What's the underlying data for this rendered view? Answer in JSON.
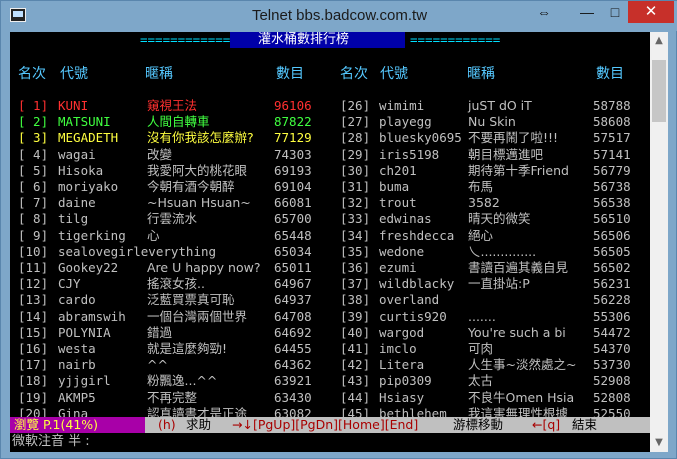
{
  "window": {
    "title": "Telnet bbs.badcow.com.tw",
    "min": "—",
    "max": "□",
    "close": "✕",
    "resize": "⇔"
  },
  "banner": {
    "left_rule": "============",
    "title": "灌水桶數排行榜",
    "right_rule": "============"
  },
  "headers": {
    "rank": "名次",
    "id": "代號",
    "nick": "暱稱",
    "count": "數目"
  },
  "left": [
    {
      "rank": "[ 1]",
      "id": "KUNI",
      "nick": "窺視王法",
      "count": "96106",
      "color": "red"
    },
    {
      "rank": "[ 2]",
      "id": "MATSUNI",
      "nick": "人間自轉車",
      "count": "87822",
      "color": "green"
    },
    {
      "rank": "[ 3]",
      "id": "MEGADETH",
      "nick": "沒有你我該怎麼辦?",
      "count": "77129",
      "color": "yellow"
    },
    {
      "rank": "[ 4]",
      "id": "wagai",
      "nick": "改變",
      "count": "74303",
      "color": "white"
    },
    {
      "rank": "[ 5]",
      "id": "Hisoka",
      "nick": "我愛阿大的桃花眼",
      "count": "69193",
      "color": "white"
    },
    {
      "rank": "[ 6]",
      "id": "moriyako",
      "nick": "今朝有酒今朝醉",
      "count": "69104",
      "color": "white"
    },
    {
      "rank": "[ 7]",
      "id": "daine",
      "nick": "~Hsuan Hsuan~",
      "count": "66081",
      "color": "white"
    },
    {
      "rank": "[ 8]",
      "id": "tilg",
      "nick": "行雲流水",
      "count": "65700",
      "color": "white"
    },
    {
      "rank": "[ 9]",
      "id": "tigerking",
      "nick": "心",
      "count": "65448",
      "color": "white"
    },
    {
      "rank": "[10]",
      "id": "sealovegirleverything",
      "nick": "",
      "count": "65034",
      "color": "white"
    },
    {
      "rank": "[11]",
      "id": "Gookey22",
      "nick": "Are U happy now?",
      "count": "65011",
      "color": "white"
    },
    {
      "rank": "[12]",
      "id": "CJY",
      "nick": "搖滾女孩..",
      "count": "64967",
      "color": "white"
    },
    {
      "rank": "[13]",
      "id": "cardo",
      "nick": "泛藍買票真可恥",
      "count": "64937",
      "color": "white"
    },
    {
      "rank": "[14]",
      "id": "abramswih",
      "nick": "一個台灣兩個世界",
      "count": "64708",
      "color": "white"
    },
    {
      "rank": "[15]",
      "id": "POLYNIA",
      "nick": "錯過",
      "count": "64692",
      "color": "white"
    },
    {
      "rank": "[16]",
      "id": "westa",
      "nick": "就是這麼夠勁!",
      "count": "64455",
      "color": "white"
    },
    {
      "rank": "[17]",
      "id": "nairb",
      "nick": "^^",
      "count": "64362",
      "color": "white"
    },
    {
      "rank": "[18]",
      "id": "yjjgirl",
      "nick": "粉飄逸...^^",
      "count": "63921",
      "color": "white"
    },
    {
      "rank": "[19]",
      "id": "AKMP5",
      "nick": "不再完整",
      "count": "63430",
      "color": "white"
    },
    {
      "rank": "[20]",
      "id": "Gina",
      "nick": "認真讀書才是正途",
      "count": "63082",
      "color": "white"
    }
  ],
  "right": [
    {
      "rank": "[26]",
      "id": "wimimi",
      "nick": "juST dO iT",
      "count": "58788"
    },
    {
      "rank": "[27]",
      "id": "playegg",
      "nick": "Nu Skin",
      "count": "58608"
    },
    {
      "rank": "[28]",
      "id": "bluesky0695",
      "nick": "不要再鬧了啦!!!",
      "count": "57517"
    },
    {
      "rank": "[29]",
      "id": "iris5198",
      "nick": "朝目標邁進吧",
      "count": "57141"
    },
    {
      "rank": "[30]",
      "id": "ch201",
      "nick": "期待第十季Friend",
      "count": "56779"
    },
    {
      "rank": "[31]",
      "id": "buma",
      "nick": "布馬",
      "count": "56738"
    },
    {
      "rank": "[32]",
      "id": "trout",
      "nick": "3582",
      "count": "56538"
    },
    {
      "rank": "[33]",
      "id": "edwinas",
      "nick": "晴天的微笑",
      "count": "56510"
    },
    {
      "rank": "[34]",
      "id": "freshdecca",
      "nick": "絕心",
      "count": "56506"
    },
    {
      "rank": "[35]",
      "id": "wedone",
      "nick": "乀..............",
      "count": "56505"
    },
    {
      "rank": "[36]",
      "id": "ezumi",
      "nick": "書讀百遍其義自見",
      "count": "56502"
    },
    {
      "rank": "[37]",
      "id": "wildblacky",
      "nick": "一直掛站:P",
      "count": "56231"
    },
    {
      "rank": "[38]",
      "id": "overland",
      "nick": "",
      "count": "56228"
    },
    {
      "rank": "[39]",
      "id": "curtis920",
      "nick": ".......",
      "count": "55306"
    },
    {
      "rank": "[40]",
      "id": "wargod",
      "nick": "You're such a bi",
      "count": "54472"
    },
    {
      "rank": "[41]",
      "id": "imclo",
      "nick": "可肉",
      "count": "54370"
    },
    {
      "rank": "[42]",
      "id": "Litera",
      "nick": "人生事~淡然處之~",
      "count": "53730"
    },
    {
      "rank": "[43]",
      "id": "pip0309",
      "nick": "太古",
      "count": "52908"
    },
    {
      "rank": "[44]",
      "id": "Hsiasy",
      "nick": "不良牛Omen Hsia",
      "count": "52808"
    },
    {
      "rank": "[45]",
      "id": "bethlehem",
      "nick": "我這害無理性根據",
      "count": "52550"
    }
  ],
  "status": {
    "mode": "瀏覽 P.1(41%)",
    "help_key": "(h)",
    "help_label": "求助",
    "move_keys": "→↓[PgUp][PgDn][Home][End]",
    "move_label": "游標移動",
    "quit_key": "←[q]",
    "quit_label": "結束"
  },
  "input": {
    "ime": "微軟注音 半 :"
  }
}
